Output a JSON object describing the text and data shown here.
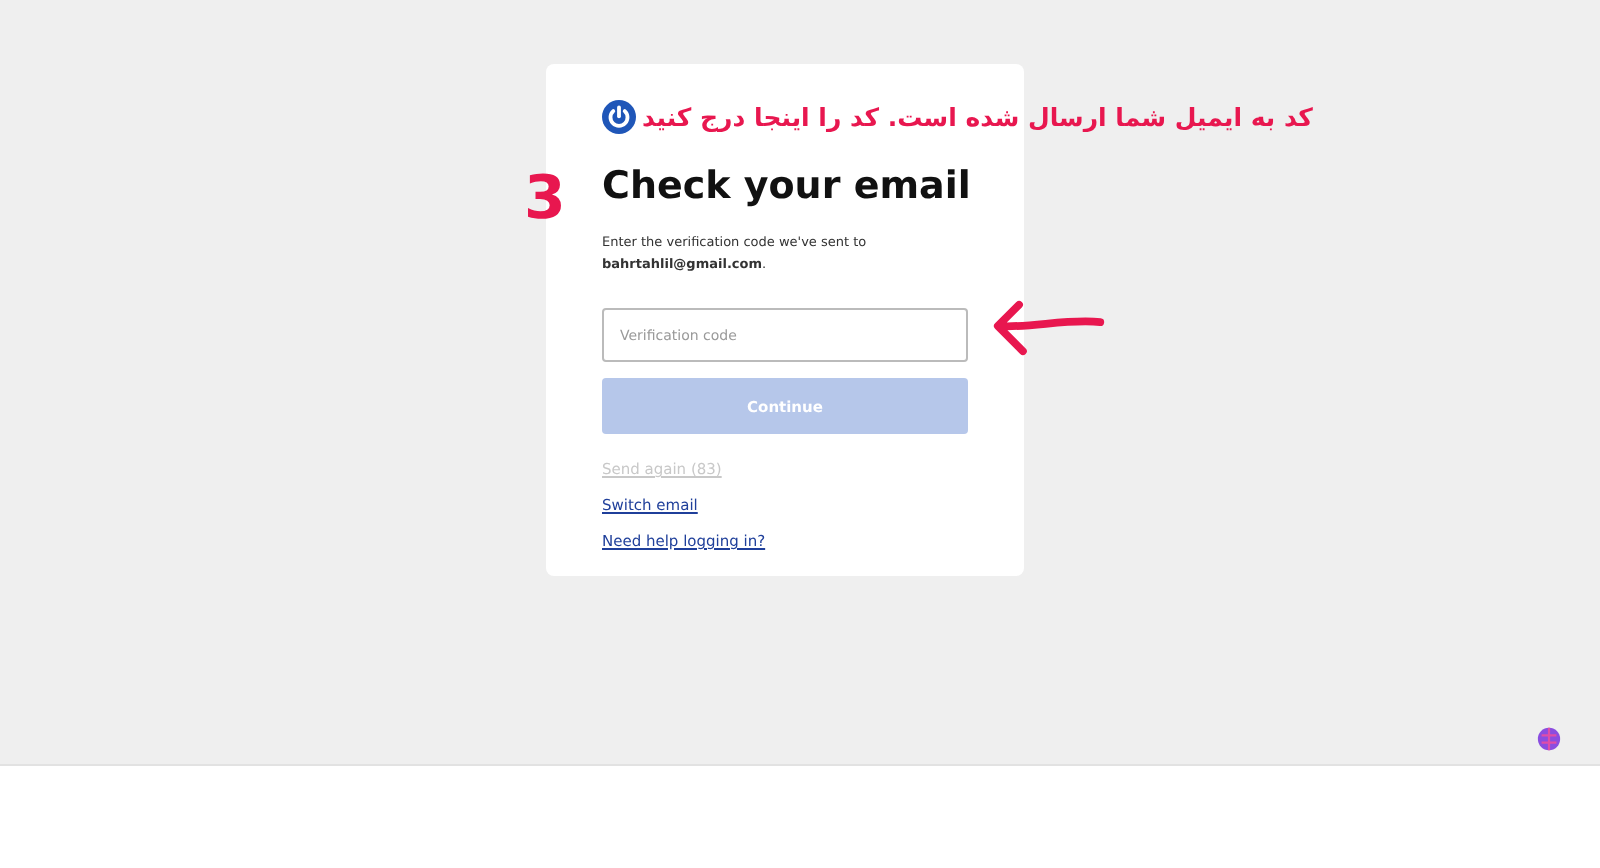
{
  "annotation": {
    "note": "کد به ایمیل شما ارسال شده است. کد را اینجا درج کنید",
    "step": "3"
  },
  "card": {
    "title": "Check your email",
    "message": "Enter the verification code we've sent to **bahrtahlil@gmail.com**.",
    "code_field": {
      "placeholder": "Verification code"
    },
    "continue_button": {
      "label": "Continue",
      "disabled": true
    },
    "links": [
      {
        "label": "Send again (83)",
        "disabled": true
      },
      {
        "label": "Switch email",
        "disabled": false
      },
      {
        "label": "Need help logging in?",
        "disabled": false
      }
    ]
  }
}
